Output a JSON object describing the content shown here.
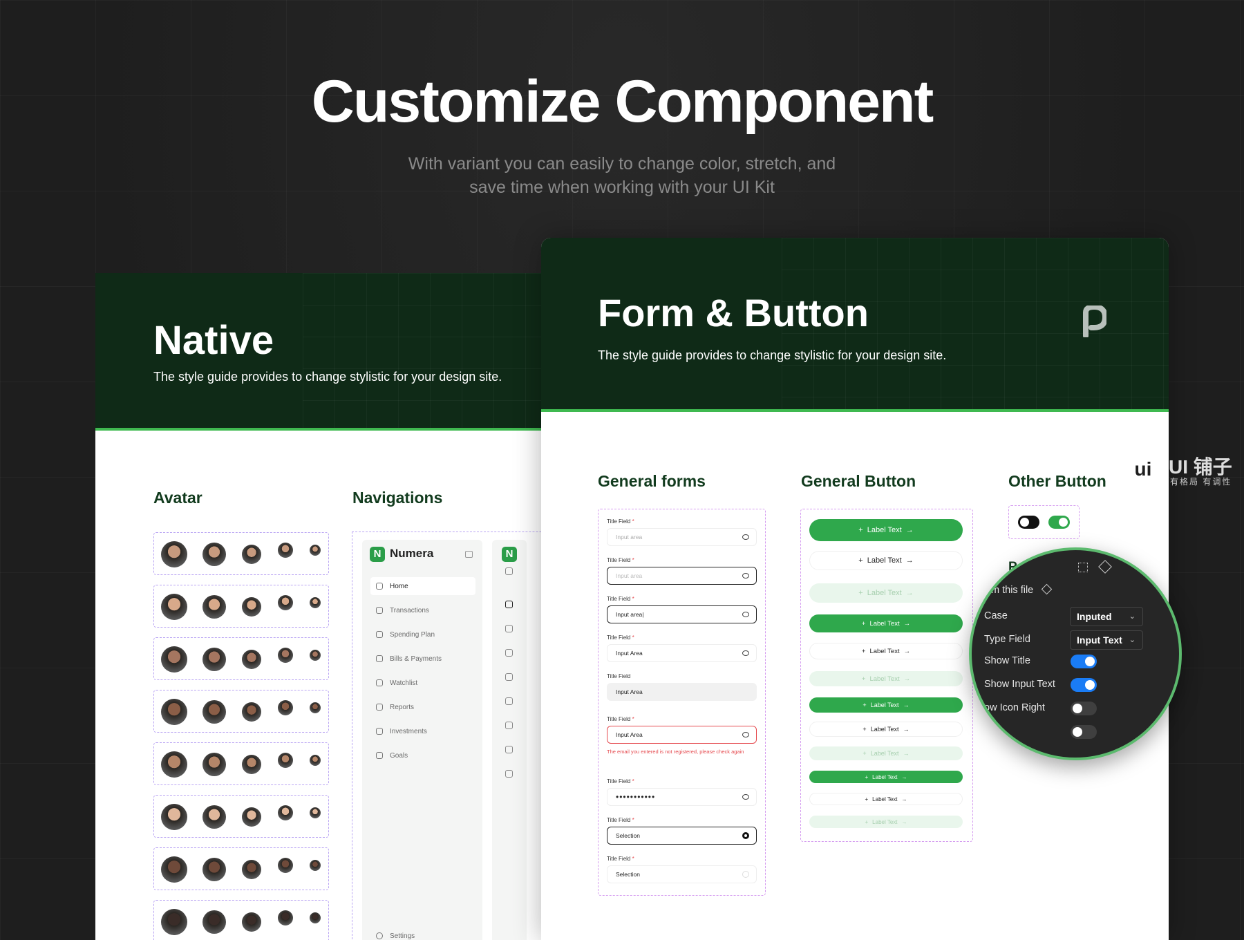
{
  "hero": {
    "title": "Customize Component",
    "subtitle_line1": "With variant you can easily to change color, stretch, and",
    "subtitle_line2": "save time when working with your UI Kit"
  },
  "native": {
    "title": "Native",
    "description": "The style guide provides to change stylistic for your design site.",
    "avatar_title": "Avatar",
    "nav_title": "Navigations",
    "nav": {
      "brand": "Numera",
      "items": [
        "Home",
        "Transactions",
        "Spending Plan",
        "Bills & Payments",
        "Watchlist",
        "Reports",
        "Investments",
        "Goals"
      ],
      "settings": "Settings"
    }
  },
  "form": {
    "title": "Form & Button",
    "description": "The style guide provides to change stylistic for your design site.",
    "general_forms_title": "General forms",
    "general_button_title": "General Button",
    "other_button_title": "Other Button",
    "fields": [
      {
        "label": "Title Field",
        "required": true,
        "value": "Input area",
        "state": "placeholder"
      },
      {
        "label": "Title Field",
        "required": true,
        "value": "Input area",
        "state": "focus"
      },
      {
        "label": "Title Field",
        "required": true,
        "value": "Input area|",
        "state": "typing"
      },
      {
        "label": "Title Field",
        "required": true,
        "value": "Input Area",
        "state": "filled"
      },
      {
        "label": "Title Field",
        "required": false,
        "value": "Input Area",
        "state": "disabled"
      },
      {
        "label": "Title Field",
        "required": true,
        "value": "Input Area",
        "state": "error"
      },
      {
        "label": "Title Field",
        "required": true,
        "value": "•••••••••••",
        "state": "password"
      },
      {
        "label": "Title Field",
        "required": true,
        "value": "Selection",
        "state": "selection-active"
      },
      {
        "label": "Title Field",
        "required": true,
        "value": "Selection",
        "state": "selection"
      }
    ],
    "error_text": "The email you entered is not registered, please check again",
    "button_label": "Label Text",
    "magnifier": {
      "header": "m this file",
      "rows": [
        {
          "label": "Case",
          "value": "Inputed"
        },
        {
          "label": "Type Field",
          "value": "Input Text"
        }
      ],
      "toggles": [
        {
          "label": "Show Title",
          "on": true
        },
        {
          "label": "Show Input Text",
          "on": true
        },
        {
          "label": "ow Icon Right",
          "on": false
        },
        {
          "label": "",
          "on": false
        }
      ]
    }
  },
  "watermark": {
    "badge": "ui",
    "text": "UI 铺子",
    "sub": "有格局 有调性"
  },
  "colors": {
    "brand_green": "#2fa84c",
    "header_dark": "#0f2a17",
    "toggle_blue": "#1a7cf5"
  }
}
